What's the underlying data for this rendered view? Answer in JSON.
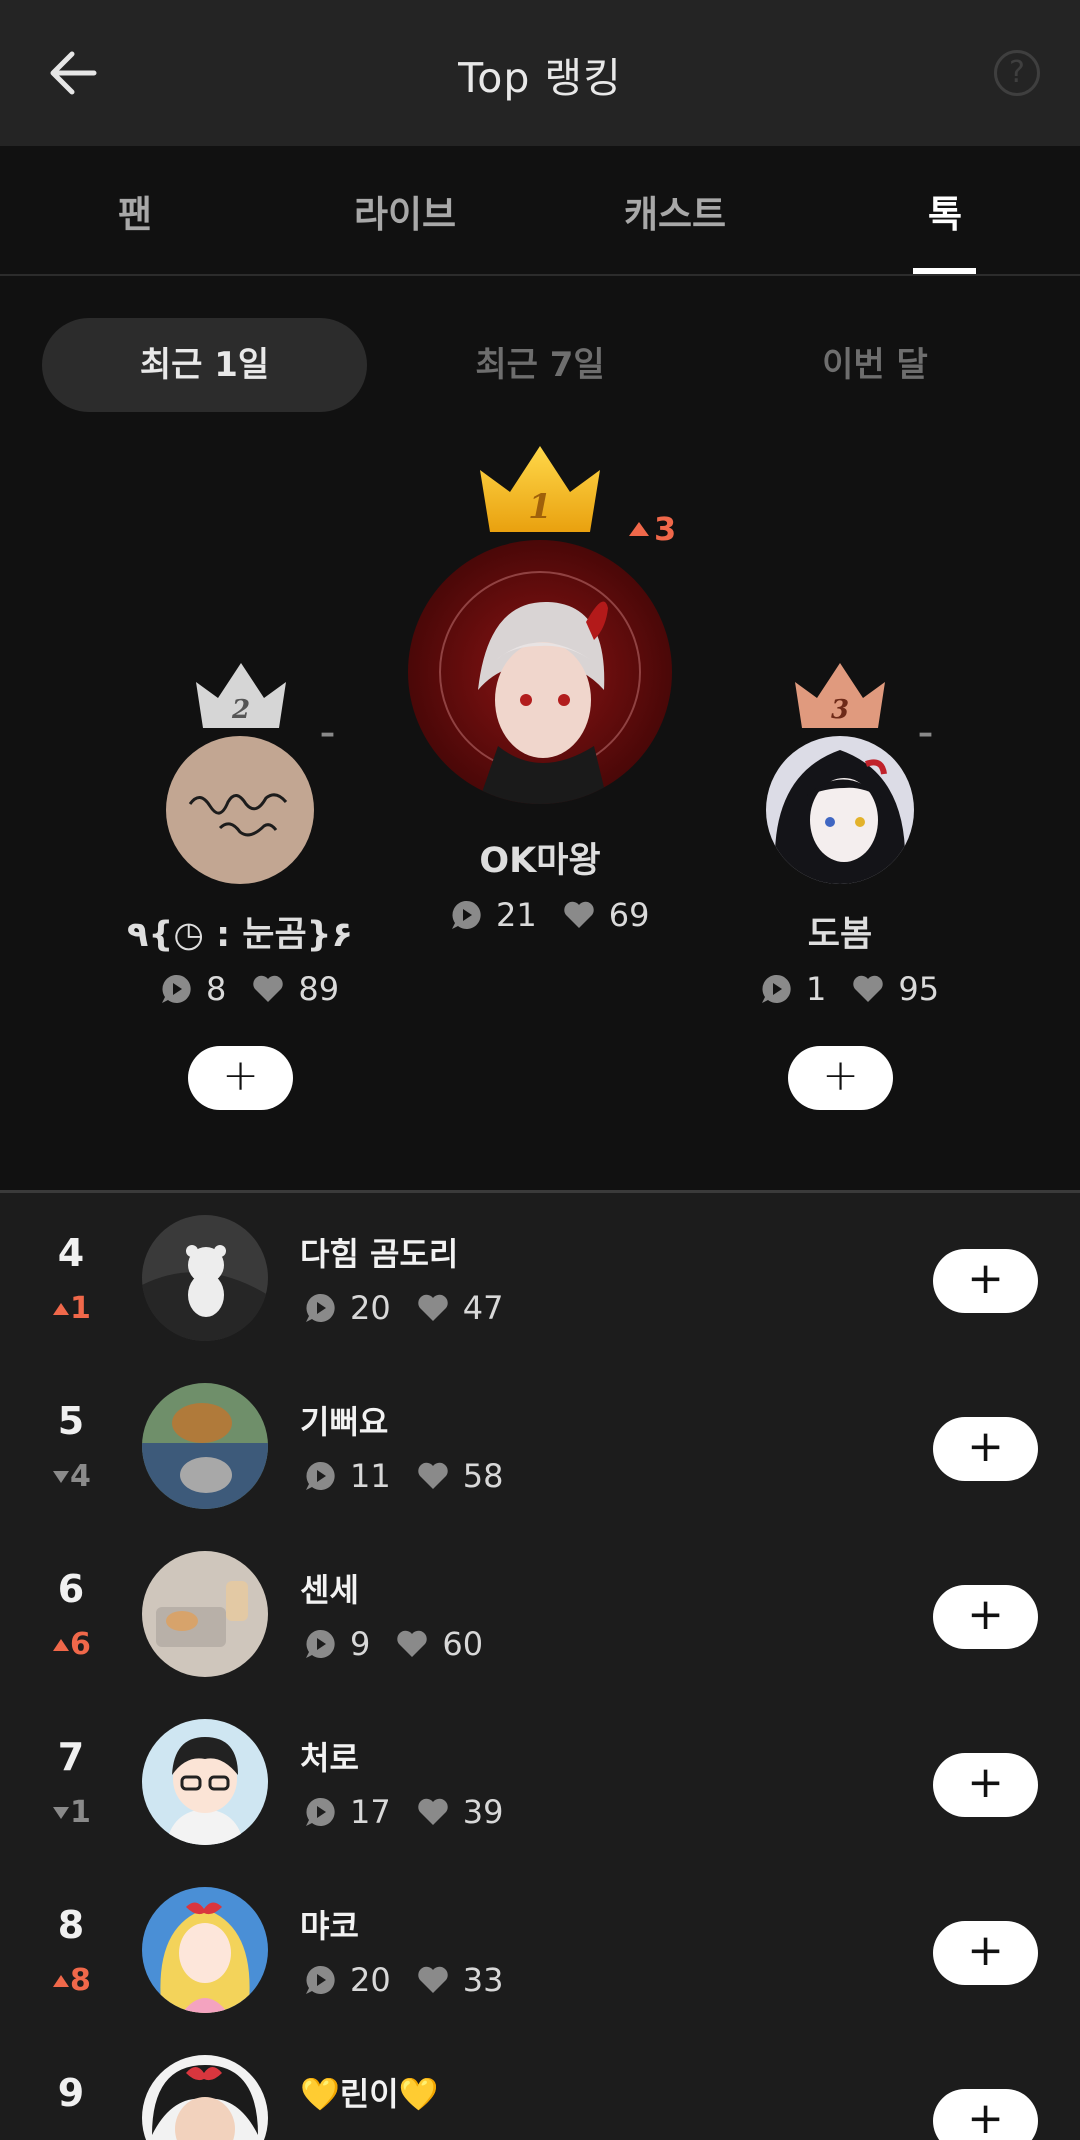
{
  "header": {
    "title": "Top 랭킹",
    "help_label": "?"
  },
  "tabs": [
    {
      "label": "팬",
      "active": false
    },
    {
      "label": "라이브",
      "active": false
    },
    {
      "label": "캐스트",
      "active": false
    },
    {
      "label": "톡",
      "active": true
    }
  ],
  "periods": [
    {
      "label": "최근 1일",
      "active": true
    },
    {
      "label": "최근 7일",
      "active": false
    },
    {
      "label": "이번 달",
      "active": false
    }
  ],
  "podium": [
    {
      "rank": "1",
      "name": "OK마왕",
      "comments": "21",
      "likes": "69",
      "change": "3",
      "change_dir": "up",
      "avatar": "red demon boy avatar"
    },
    {
      "rank": "2",
      "name": "٩{◷ : 눈곰}۶",
      "comments": "8",
      "likes": "89",
      "change": "–",
      "change_dir": "none",
      "avatar": "signature avatar"
    },
    {
      "rank": "3",
      "name": "도봄",
      "comments": "1",
      "likes": "95",
      "change": "–",
      "change_dir": "none",
      "avatar": "dark haired girl avatar"
    }
  ],
  "add_label": "+",
  "list": [
    {
      "rank": "4",
      "change": "1",
      "change_dir": "up",
      "name": "다힘 곰도리",
      "comments": "20",
      "likes": "47"
    },
    {
      "rank": "5",
      "change": "4",
      "change_dir": "down",
      "name": "기뻐요",
      "comments": "11",
      "likes": "58"
    },
    {
      "rank": "6",
      "change": "6",
      "change_dir": "up",
      "name": "센세",
      "comments": "9",
      "likes": "60"
    },
    {
      "rank": "7",
      "change": "1",
      "change_dir": "down",
      "name": "처로",
      "comments": "17",
      "likes": "39"
    },
    {
      "rank": "8",
      "change": "8",
      "change_dir": "up",
      "name": "먀코",
      "comments": "20",
      "likes": "33"
    },
    {
      "rank": "9",
      "change": "",
      "change_dir": "none",
      "name": "💛린이💛",
      "comments": "",
      "likes": ""
    }
  ],
  "colors": {
    "up": "#f0684a",
    "down": "#8a8a8a",
    "gold": "#f6bd1c",
    "silver": "#d6d6d6",
    "bronze": "#e09a7e"
  }
}
